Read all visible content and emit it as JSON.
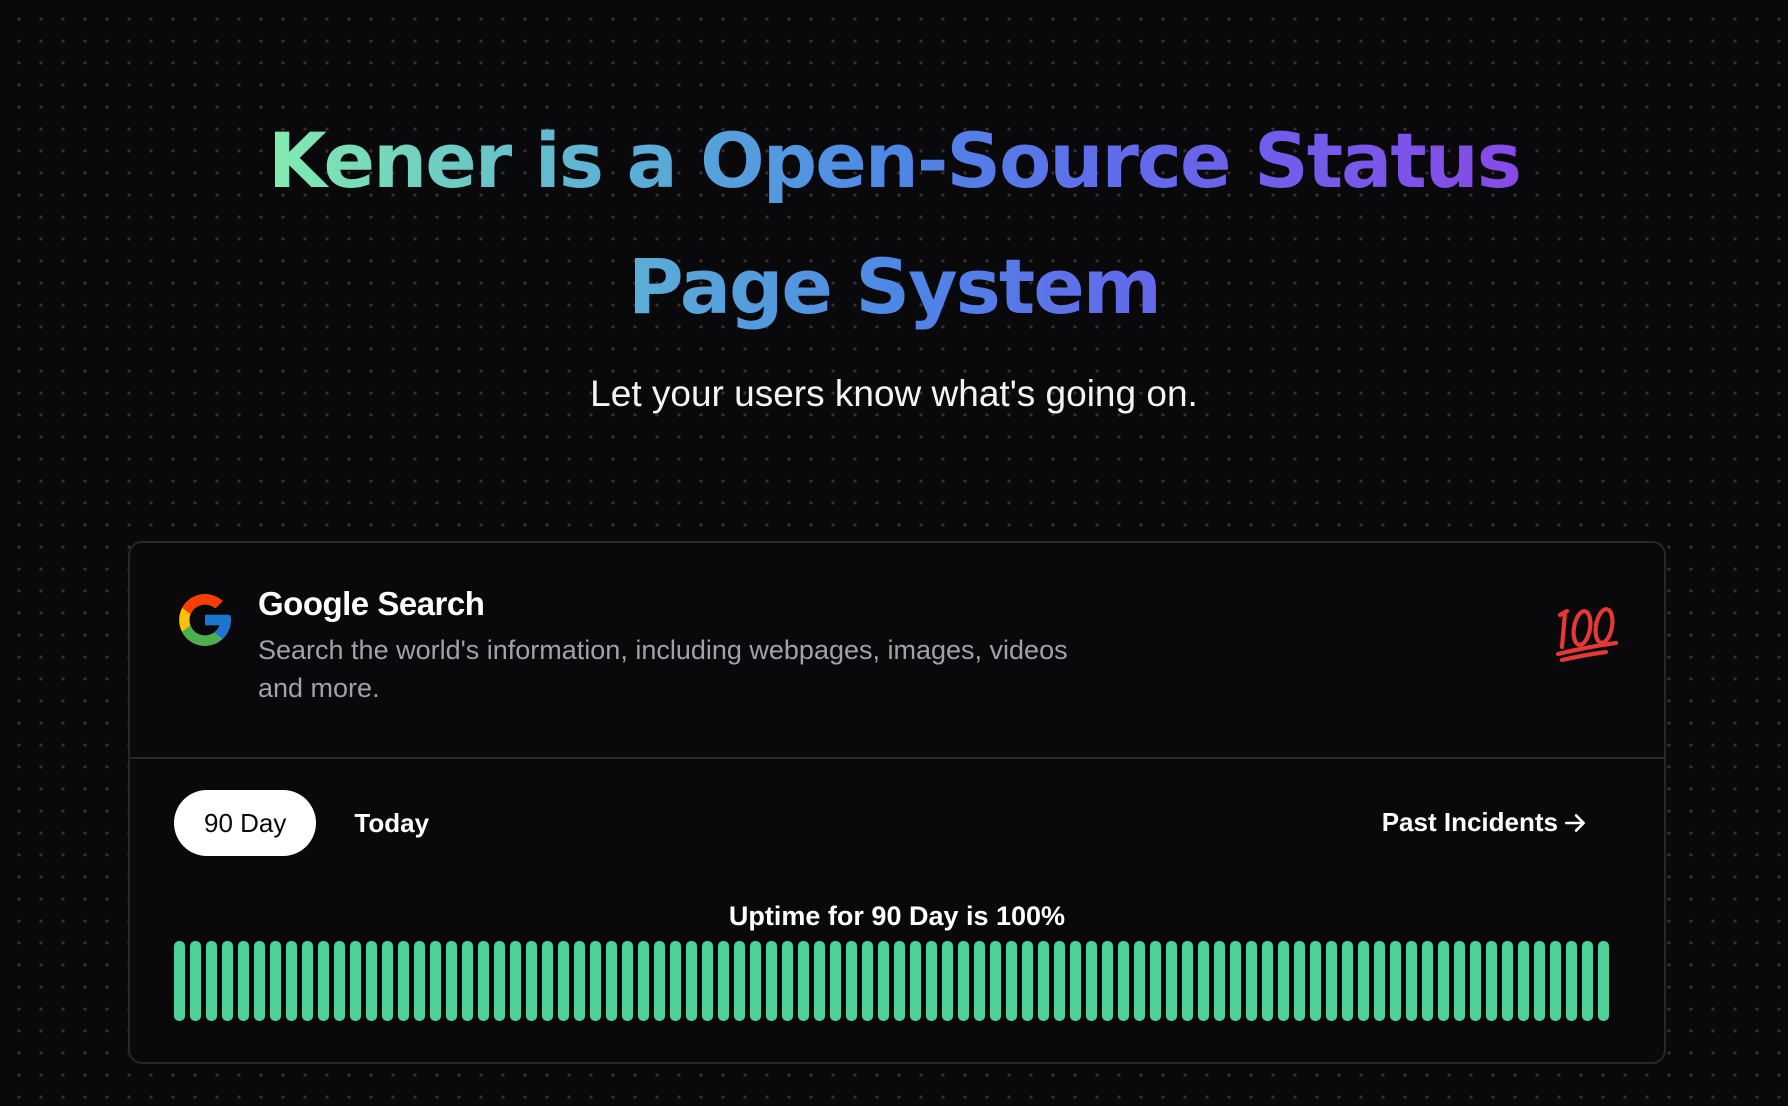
{
  "hero": {
    "title_line1": "Kener is a Open-Source Status",
    "title_line2": "Page System",
    "subtitle": "Let your users know what's going on."
  },
  "monitor": {
    "name": "Google Search",
    "description": "Search the world's information, including webpages, images, videos and more.",
    "logo_icon": "google-g-icon",
    "status_icon": "hundred-points-icon",
    "tabs": [
      {
        "label": "90 Day",
        "active": true
      },
      {
        "label": "Today",
        "active": false
      }
    ],
    "past_incidents_label": "Past Incidents",
    "uptime_text": "Uptime for 90 Day is 100%",
    "uptime_percent": 100,
    "bar_count": 90,
    "bar_status": "up"
  },
  "colors": {
    "background": "#09090b",
    "border": "#27272a",
    "up": "#4fd19a",
    "muted_text": "#a1a1aa",
    "gradient": [
      "#86efac",
      "#5eb5d2",
      "#4e87e6",
      "#6468ea",
      "#8a48e8"
    ],
    "status_emoji": "#e53935"
  }
}
